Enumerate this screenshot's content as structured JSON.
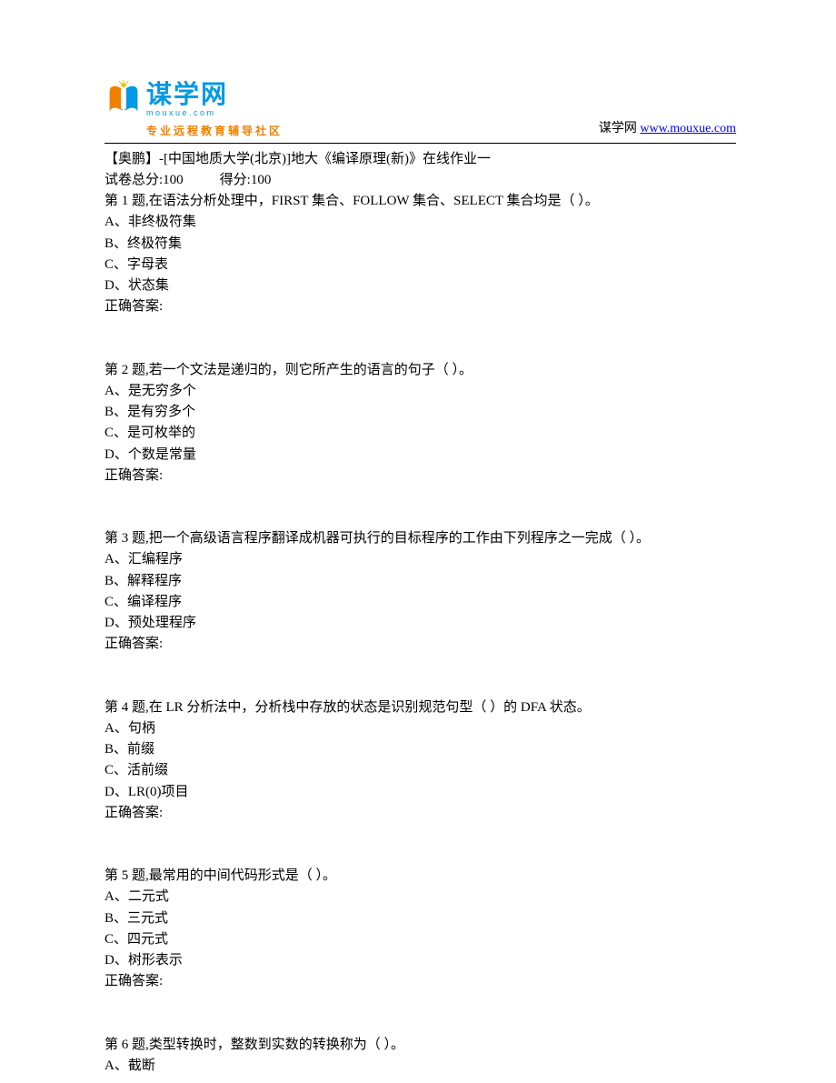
{
  "header": {
    "logo_title": "谋学网",
    "logo_pinyin": "mouxue.com",
    "logo_tagline": "专业远程教育辅导社区",
    "right_text": "谋学网 ",
    "right_link": "www.mouxue.com"
  },
  "doc": {
    "title": "【奥鹏】-[中国地质大学(北京)]地大《编译原理(新)》在线作业一",
    "score_total_label": "试卷总分:100",
    "score_got_label": "得分:100"
  },
  "answer_label": "正确答案:",
  "questions": [
    {
      "q": "第 1 题,在语法分析处理中，FIRST 集合、FOLLOW 集合、SELECT 集合均是（ ）。",
      "opts": [
        "A、非终极符集",
        "B、终极符集",
        "C、字母表",
        "D、状态集"
      ]
    },
    {
      "q": "第 2 题,若一个文法是递归的，则它所产生的语言的句子（ ）。",
      "opts": [
        "A、是无穷多个",
        "B、是有穷多个",
        "C、是可枚举的",
        "D、个数是常量"
      ]
    },
    {
      "q": "第 3 题,把一个高级语言程序翻译成机器可执行的目标程序的工作由下列程序之一完成（ ）。",
      "opts": [
        "A、汇编程序",
        "B、解释程序",
        "C、编译程序",
        "D、预处理程序"
      ]
    },
    {
      "q": "第 4 题,在 LR 分析法中，分析栈中存放的状态是识别规范句型（ ）的 DFA 状态。",
      "opts": [
        "A、句柄",
        "B、前缀",
        "C、活前缀",
        "D、LR(0)项目"
      ]
    },
    {
      "q": "第 5 题,最常用的中间代码形式是（ ）。",
      "opts": [
        "A、二元式",
        "B、三元式",
        "C、四元式",
        "D、树形表示"
      ]
    },
    {
      "q": "第 6 题,类型转换时，整数到实数的转换称为（ ）。",
      "opts": [
        "A、截断"
      ]
    }
  ]
}
